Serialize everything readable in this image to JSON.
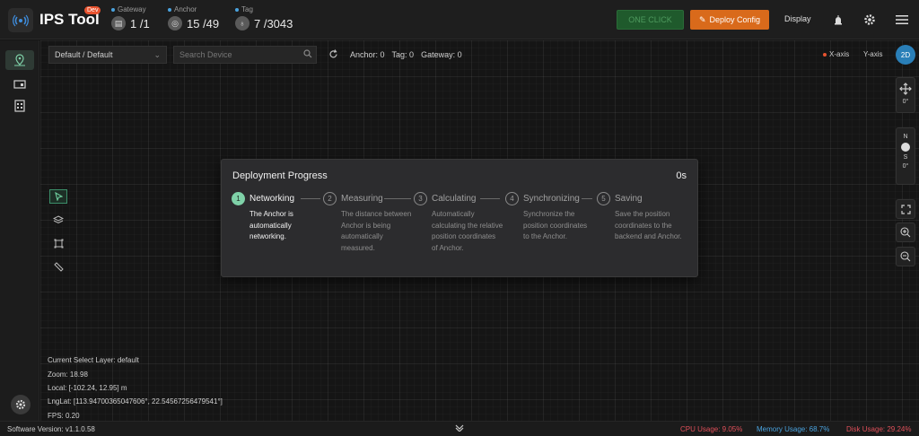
{
  "header": {
    "app_title": "IPS Tool",
    "badge": "Dev",
    "gateway": {
      "label": "Gateway",
      "value": "1 /1"
    },
    "anchor": {
      "label": "Anchor",
      "value": "15 /49"
    },
    "tag": {
      "label": "Tag",
      "value": "7 /3043"
    },
    "one_click": "ONE CLICK",
    "deploy_config": "Deploy Config",
    "display": "Display"
  },
  "toolbar": {
    "layer_select": "Default / Default",
    "search_placeholder": "Search Device",
    "anchor_count": "Anchor: 0",
    "tag_count": "Tag: 0",
    "gateway_count": "Gateway: 0",
    "x_axis": "X-axis",
    "y_axis": "Y-axis",
    "view_mode": "2D"
  },
  "right_panel": {
    "move_angle": "0°",
    "compass_n": "N",
    "compass_s": "S",
    "compass_angle": "0°"
  },
  "info": {
    "layer": "Current Select Layer:   default",
    "zoom": "Zoom:   18.98",
    "local": "Local:   [-102.24,  12.95] m",
    "lnglat": "LngLat:   [113.94700365047606°,  22.54567256479541°]",
    "fps": "FPS:   0.20"
  },
  "footer": {
    "version": "Software Version:  v1.1.0.58",
    "cpu": "CPU Usage:  9.05%",
    "memory": "Memory Usage:  68.7%",
    "disk": "Disk Usage:  29.24%"
  },
  "modal": {
    "title": "Deployment Progress",
    "time": "0s",
    "steps": [
      {
        "num": "1",
        "title": "Networking",
        "desc": [
          "The Anchor is",
          "automatically",
          "networking."
        ]
      },
      {
        "num": "2",
        "title": "Measuring",
        "desc": [
          "The distance between",
          "Anchor is being",
          "automatically",
          "measured."
        ]
      },
      {
        "num": "3",
        "title": "Calculating",
        "desc": [
          "Automatically",
          "calculating the relative",
          "position coordinates",
          "of Anchor."
        ]
      },
      {
        "num": "4",
        "title": "Synchronizing",
        "desc": [
          "Synchronize the",
          "position coordinates",
          "to the Anchor."
        ]
      },
      {
        "num": "5",
        "title": "Saving",
        "desc": [
          "Save the position",
          "coordinates to the",
          "backend and Anchor."
        ]
      }
    ]
  },
  "colors": {
    "accent_green": "#7fd1a8",
    "deploy_orange": "#d96a1b",
    "cpu": "#e0505a",
    "memory": "#4aa3df",
    "disk": "#e0505a"
  }
}
